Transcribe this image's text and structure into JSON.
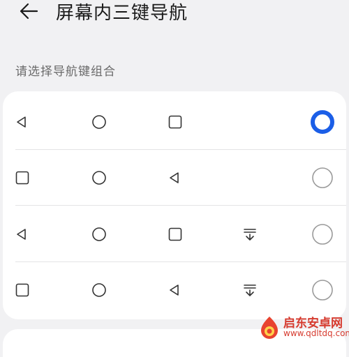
{
  "header": {
    "title": "屏幕内三键导航",
    "back_icon": "arrow-left-icon"
  },
  "section": {
    "label": "请选择导航键组合"
  },
  "accent_color": "#1b5ee7",
  "options": [
    {
      "keys": [
        "back-triangle-icon",
        "home-circle-icon",
        "recents-square-icon",
        ""
      ],
      "selected": true
    },
    {
      "keys": [
        "recents-square-icon",
        "home-circle-icon",
        "back-triangle-icon",
        ""
      ],
      "selected": false
    },
    {
      "keys": [
        "back-triangle-icon",
        "home-circle-icon",
        "recents-square-icon",
        "notification-pulldown-icon"
      ],
      "selected": false
    },
    {
      "keys": [
        "recents-square-icon",
        "home-circle-icon",
        "back-triangle-icon",
        "notification-pulldown-icon"
      ],
      "selected": false
    }
  ],
  "watermark": {
    "text": "启东安卓网",
    "url": "www.qdltdq.com"
  }
}
